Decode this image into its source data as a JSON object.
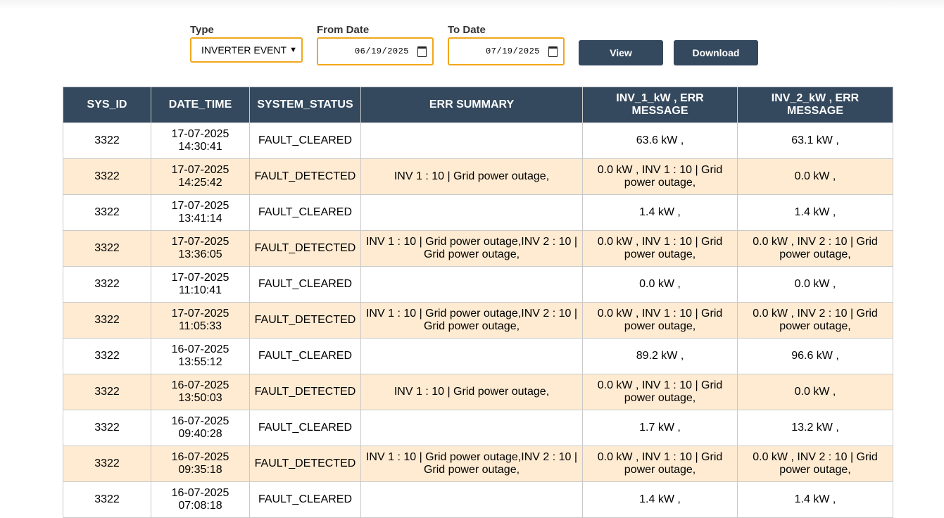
{
  "filters": {
    "type_label": "Type",
    "type_value": "INVERTER EVENT",
    "from_label": "From Date",
    "from_value": "06/19/2025",
    "to_label": "To Date",
    "to_value": "07/19/2025",
    "view_label": "View",
    "download_label": "Download"
  },
  "table": {
    "headers": [
      "SYS_ID",
      "DATE_TIME",
      "SYSTEM_STATUS",
      "ERR SUMMARY",
      "INV_1_kW , ERR MESSAGE",
      "INV_2_kW , ERR MESSAGE"
    ],
    "rows": [
      {
        "sys_id": "3322",
        "date": "17-07-2025",
        "time": "14:30:41",
        "status": "FAULT_CLEARED",
        "summary": "",
        "inv1": "63.6 kW ,",
        "inv2": "63.1 kW ,"
      },
      {
        "sys_id": "3322",
        "date": "17-07-2025",
        "time": "14:25:42",
        "status": "FAULT_DETECTED",
        "summary": "INV 1 : 10 | Grid power outage,",
        "inv1": "0.0 kW , INV 1 : 10 | Grid power outage,",
        "inv2": "0.0 kW ,"
      },
      {
        "sys_id": "3322",
        "date": "17-07-2025",
        "time": "13:41:14",
        "status": "FAULT_CLEARED",
        "summary": "",
        "inv1": "1.4 kW ,",
        "inv2": "1.4 kW ,"
      },
      {
        "sys_id": "3322",
        "date": "17-07-2025",
        "time": "13:36:05",
        "status": "FAULT_DETECTED",
        "summary": "INV 1 : 10 | Grid power outage,INV 2 : 10 | Grid power outage,",
        "inv1": "0.0 kW , INV 1 : 10 | Grid power outage,",
        "inv2": "0.0 kW , INV 2 : 10 | Grid power outage,"
      },
      {
        "sys_id": "3322",
        "date": "17-07-2025",
        "time": "11:10:41",
        "status": "FAULT_CLEARED",
        "summary": "",
        "inv1": "0.0 kW ,",
        "inv2": "0.0 kW ,"
      },
      {
        "sys_id": "3322",
        "date": "17-07-2025",
        "time": "11:05:33",
        "status": "FAULT_DETECTED",
        "summary": "INV 1 : 10 | Grid power outage,INV 2 : 10 | Grid power outage,",
        "inv1": "0.0 kW , INV 1 : 10 | Grid power outage,",
        "inv2": "0.0 kW , INV 2 : 10 | Grid power outage,"
      },
      {
        "sys_id": "3322",
        "date": "16-07-2025",
        "time": "13:55:12",
        "status": "FAULT_CLEARED",
        "summary": "",
        "inv1": "89.2 kW ,",
        "inv2": "96.6 kW ,"
      },
      {
        "sys_id": "3322",
        "date": "16-07-2025",
        "time": "13:50:03",
        "status": "FAULT_DETECTED",
        "summary": "INV 1 : 10 | Grid power outage,",
        "inv1": "0.0 kW , INV 1 : 10 | Grid power outage,",
        "inv2": "0.0 kW ,"
      },
      {
        "sys_id": "3322",
        "date": "16-07-2025",
        "time": "09:40:28",
        "status": "FAULT_CLEARED",
        "summary": "",
        "inv1": "1.7 kW ,",
        "inv2": "13.2 kW ,"
      },
      {
        "sys_id": "3322",
        "date": "16-07-2025",
        "time": "09:35:18",
        "status": "FAULT_DETECTED",
        "summary": "INV 1 : 10 | Grid power outage,INV 2 : 10 | Grid power outage,",
        "inv1": "0.0 kW , INV 1 : 10 | Grid power outage,",
        "inv2": "0.0 kW , INV 2 : 10 | Grid power outage,"
      },
      {
        "sys_id": "3322",
        "date": "16-07-2025",
        "time": "07:08:18",
        "status": "FAULT_CLEARED",
        "summary": "",
        "inv1": "1.4 kW ,",
        "inv2": "1.4 kW ,"
      }
    ]
  },
  "colors": {
    "header_bg": "#34495e",
    "odd_row_bg": "#ffebd2",
    "input_border": "#f2a71b",
    "button_bg": "#34495e"
  },
  "icons": {
    "type_select": "chevron-down-icon",
    "date_picker": "calendar-icon"
  }
}
